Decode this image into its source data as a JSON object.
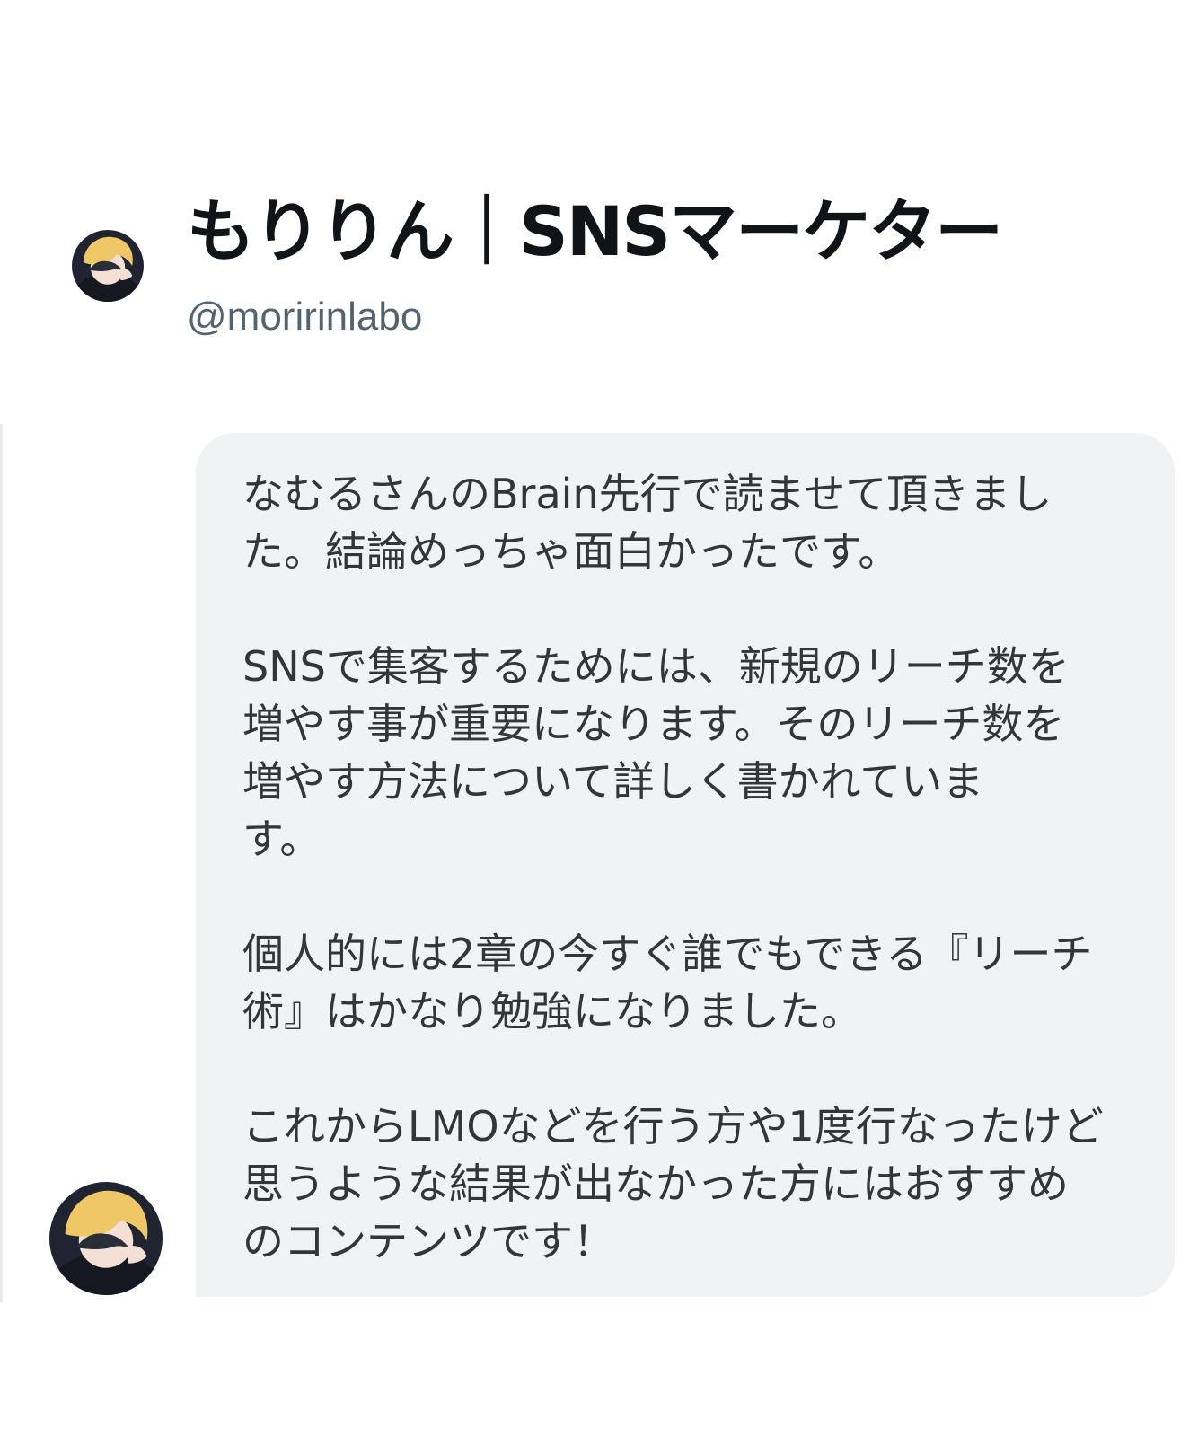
{
  "profile": {
    "display_name": "もりりん｜SNSマーケター",
    "handle": "@moririnlabo",
    "avatar_icon": "user-avatar-icon"
  },
  "message": {
    "paragraphs": [
      "なむるさんのBrain先行で読ませて頂きまし\nた。結論めっちゃ面白かったです。",
      "SNSで集客するためには、新規のリーチ数を\n増やす事が重要になります。そのリーチ数を\n増やす方法について詳しく書かれていま\nす。",
      "個人的には2章の今すぐ誰でもできる『リーチ\n術』はかなり勉強になりました。",
      "これからLMOなどを行う方や1度行なったけど\n思うような結果が出なかった方にはおすすめ\nのコンテンツです！"
    ]
  },
  "colors": {
    "name": "#0f1419",
    "handle": "#536471",
    "bubble": "#eff3f4",
    "text": "#333638"
  }
}
